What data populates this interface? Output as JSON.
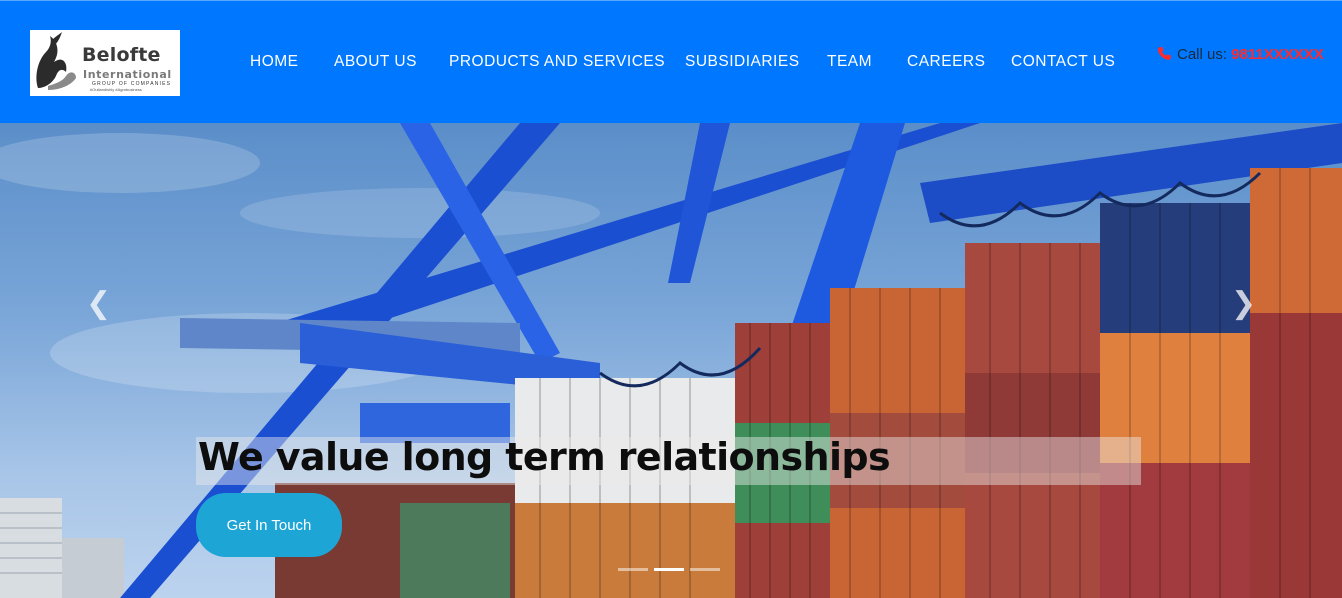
{
  "logo": {
    "name": "Belofte",
    "subtitle": "International",
    "group": "GROUP OF COMPANIES",
    "tagline": "#Outlandishly #Agrobusiness"
  },
  "nav": {
    "items": [
      {
        "label": "HOME"
      },
      {
        "label": "ABOUT US"
      },
      {
        "label": "PRODUCTS AND SERVICES"
      },
      {
        "label": "SUBSIDIARIES"
      },
      {
        "label": "TEAM"
      },
      {
        "label": "CAREERS"
      },
      {
        "label": "CONTACT US"
      }
    ]
  },
  "contact": {
    "label": "Call us:",
    "number": "9811XXXXXX",
    "icon": "phone-icon"
  },
  "hero": {
    "headline": "We value long term relationships",
    "cta_label": "Get In Touch",
    "prev_icon": "chevron-left-icon",
    "next_icon": "chevron-right-icon",
    "slides_total": 3,
    "active_slide": 2
  },
  "colors": {
    "header_bg": "#0077ff",
    "cta_bg": "#1da5d6",
    "phone_number": "#ff2a2a"
  }
}
